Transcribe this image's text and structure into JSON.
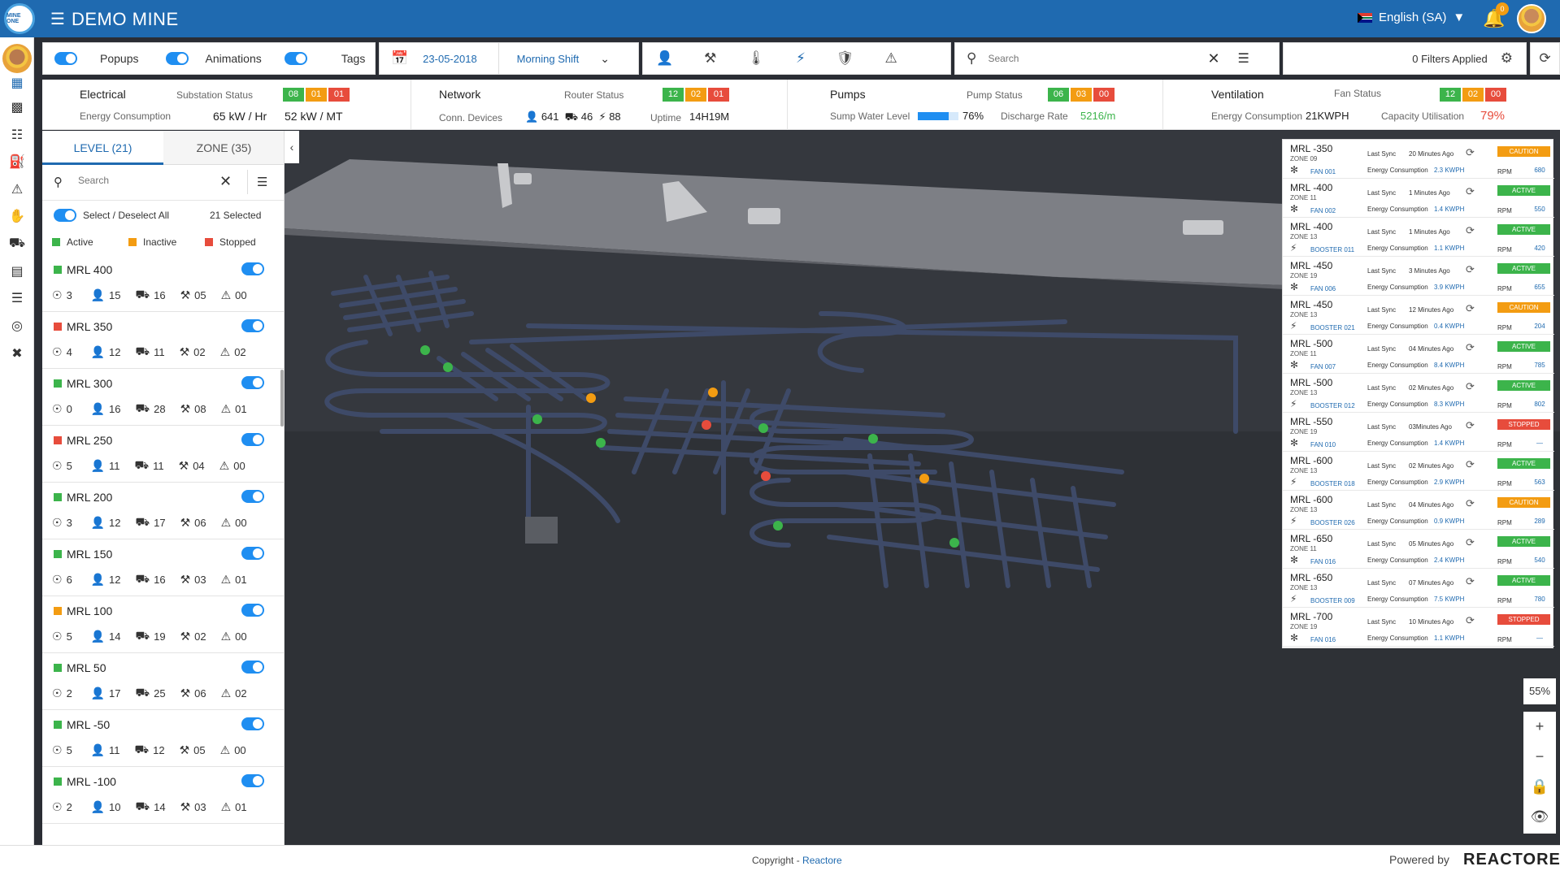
{
  "header": {
    "title": "DEMO MINE",
    "logo_text": "MINE ONE",
    "language": "English (SA)",
    "notifications": "0"
  },
  "toolbar": {
    "popups": "Popups",
    "animations": "Animations",
    "tags": "Tags",
    "date": "23-05-2018",
    "shift": "Morning Shift",
    "search_placeholder": "Search",
    "filters": "0 Filters Applied"
  },
  "status": {
    "electrical": {
      "title": "Electrical",
      "status_label": "Substation Status",
      "badges": [
        "08",
        "01",
        "01"
      ],
      "energy_label": "Energy Consumption",
      "v1": "65 kW / Hr",
      "v2": "52 kW / MT"
    },
    "network": {
      "title": "Network",
      "status_label": "Router Status",
      "badges": [
        "12",
        "02",
        "01"
      ],
      "devices_label": "Conn. Devices",
      "d1": "641",
      "d2": "46",
      "d3": "88",
      "uptime_label": "Uptime",
      "uptime": "14H19M"
    },
    "pumps": {
      "title": "Pumps",
      "status_label": "Pump Status",
      "badges": [
        "06",
        "03",
        "00"
      ],
      "sump_label": "Sump Water Level",
      "sump": "76%",
      "sump_level": 76,
      "discharge_label": "Discharge Rate",
      "discharge": "5216/m"
    },
    "ventilation": {
      "title": "Ventilation",
      "status_label": "Fan Status",
      "badges": [
        "12",
        "02",
        "00"
      ],
      "energy_label": "Energy Consumption",
      "energy": "21KWPH",
      "cap_label": "Capacity Utilisation",
      "cap": "79%"
    }
  },
  "panel": {
    "tab_level": "LEVEL (21)",
    "tab_zone": "ZONE (35)",
    "search_placeholder": "Search",
    "select_all": "Select / Deselect All",
    "selected": "21  Selected",
    "legend": [
      "Active",
      "Inactive",
      "Stopped"
    ],
    "levels": [
      {
        "name": "MRL 400",
        "status": "green",
        "a": "3",
        "b": "15",
        "c": "16",
        "d": "05",
        "e": "00"
      },
      {
        "name": "MRL 350",
        "status": "red",
        "a": "4",
        "b": "12",
        "c": "11",
        "d": "02",
        "e": "02"
      },
      {
        "name": "MRL 300",
        "status": "green",
        "a": "0",
        "b": "16",
        "c": "28",
        "d": "08",
        "e": "01"
      },
      {
        "name": "MRL 250",
        "status": "red",
        "a": "5",
        "b": "11",
        "c": "11",
        "d": "04",
        "e": "00"
      },
      {
        "name": "MRL 200",
        "status": "green",
        "a": "3",
        "b": "12",
        "c": "17",
        "d": "06",
        "e": "00"
      },
      {
        "name": "MRL 150",
        "status": "green",
        "a": "6",
        "b": "12",
        "c": "16",
        "d": "03",
        "e": "01"
      },
      {
        "name": "MRL 100",
        "status": "orange",
        "a": "5",
        "b": "14",
        "c": "19",
        "d": "02",
        "e": "00"
      },
      {
        "name": "MRL 50",
        "status": "green",
        "a": "2",
        "b": "17",
        "c": "25",
        "d": "06",
        "e": "02"
      },
      {
        "name": "MRL -50",
        "status": "green",
        "a": "5",
        "b": "11",
        "c": "12",
        "d": "05",
        "e": "00"
      },
      {
        "name": "MRL -100",
        "status": "green",
        "a": "2",
        "b": "10",
        "c": "14",
        "d": "03",
        "e": "01"
      }
    ]
  },
  "fans_labels": {
    "sync": "Last Sync",
    "energy": "Energy Consumption",
    "rpm": "RPM"
  },
  "fans": [
    {
      "mrl": "MRL -350",
      "zone": "ZONE 09",
      "type": "fan",
      "name": "FAN 001",
      "sync": "20 Minutes Ago",
      "energy": "2.3 KWPH",
      "state": "CAUTION",
      "rpm": "680"
    },
    {
      "mrl": "MRL -400",
      "zone": "ZONE 11",
      "type": "fan",
      "name": "FAN 002",
      "sync": "1 Minutes Ago",
      "energy": "1.4 KWPH",
      "state": "ACTIVE",
      "rpm": "550"
    },
    {
      "mrl": "MRL -400",
      "zone": "ZONE 13",
      "type": "booster",
      "name": "BOOSTER 011",
      "sync": "1 Minutes Ago",
      "energy": "1.1 KWPH",
      "state": "ACTIVE",
      "rpm": "420"
    },
    {
      "mrl": "MRL -450",
      "zone": "ZONE 19",
      "type": "fan",
      "name": "FAN 006",
      "sync": "3 Minutes Ago",
      "energy": "3.9 KWPH",
      "state": "ACTIVE",
      "rpm": "655"
    },
    {
      "mrl": "MRL -450",
      "zone": "ZONE 13",
      "type": "booster",
      "name": "BOOSTER 021",
      "sync": "12 Minutes Ago",
      "energy": "0.4 KWPH",
      "state": "CAUTION",
      "rpm": "204"
    },
    {
      "mrl": "MRL -500",
      "zone": "ZONE 11",
      "type": "fan",
      "name": "FAN 007",
      "sync": "04 Minutes Ago",
      "energy": "8.4 KWPH",
      "state": "ACTIVE",
      "rpm": "785"
    },
    {
      "mrl": "MRL -500",
      "zone": "ZONE 13",
      "type": "booster",
      "name": "BOOSTER 012",
      "sync": "02 Minutes Ago",
      "energy": "8.3 KWPH",
      "state": "ACTIVE",
      "rpm": "802"
    },
    {
      "mrl": "MRL -550",
      "zone": "ZONE 19",
      "type": "fan",
      "name": "FAN 010",
      "sync": "03Minutes Ago",
      "energy": "1.4 KWPH",
      "state": "STOPPED",
      "rpm": "—"
    },
    {
      "mrl": "MRL -600",
      "zone": "ZONE 13",
      "type": "booster",
      "name": "BOOSTER 018",
      "sync": "02 Minutes Ago",
      "energy": "2.9 KWPH",
      "state": "ACTIVE",
      "rpm": "563"
    },
    {
      "mrl": "MRL -600",
      "zone": "ZONE 13",
      "type": "booster",
      "name": "BOOSTER 026",
      "sync": "04 Minutes Ago",
      "energy": "0.9 KWPH",
      "state": "CAUTION",
      "rpm": "289"
    },
    {
      "mrl": "MRL -650",
      "zone": "ZONE 11",
      "type": "fan",
      "name": "FAN 016",
      "sync": "05 Minutes Ago",
      "energy": "2.4 KWPH",
      "state": "ACTIVE",
      "rpm": "540"
    },
    {
      "mrl": "MRL -650",
      "zone": "ZONE 13",
      "type": "booster",
      "name": "BOOSTER 009",
      "sync": "07 Minutes Ago",
      "energy": "7.5 KWPH",
      "state": "ACTIVE",
      "rpm": "780"
    },
    {
      "mrl": "MRL -700",
      "zone": "ZONE 19",
      "type": "fan",
      "name": "FAN 016",
      "sync": "10 Minutes Ago",
      "energy": "1.1 KWPH",
      "state": "STOPPED",
      "rpm": "—"
    }
  ],
  "zoom": {
    "level": "55%"
  },
  "footer": {
    "copyright": "Copyright - ",
    "link": "Reactore",
    "powered": "Powered by",
    "brand": "REACTORE"
  },
  "colors": {
    "primary": "#1f6ab0",
    "active": "#3cb44b",
    "caution": "#f39c12",
    "stopped": "#e74c3c"
  }
}
